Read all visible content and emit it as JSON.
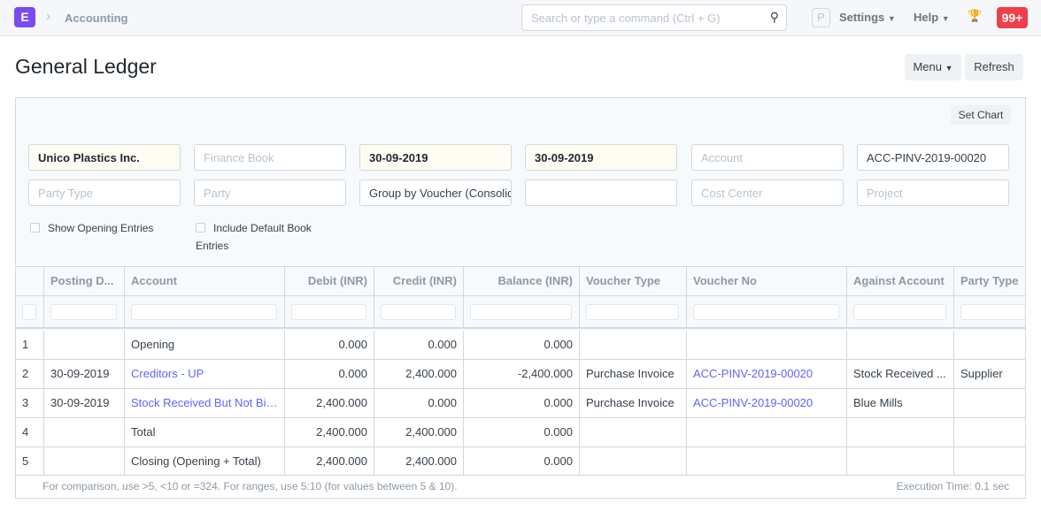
{
  "nav": {
    "logo": "E",
    "breadcrumb": "Accounting",
    "search_placeholder": "Search or type a command (Ctrl + G)",
    "avatar": "P",
    "settings": "Settings",
    "help": "Help",
    "notifications": "99+"
  },
  "page": {
    "title": "General Ledger",
    "menu": "Menu",
    "refresh": "Refresh",
    "set_chart": "Set Chart"
  },
  "filters": {
    "company": "Unico Plastics Inc.",
    "finance_book_ph": "Finance Book",
    "from_date": "30-09-2019",
    "to_date": "30-09-2019",
    "account_ph": "Account",
    "voucher_no": "ACC-PINV-2019-00020",
    "party_type_ph": "Party Type",
    "party_ph": "Party",
    "group_by": "Group by Voucher (Consolidated)",
    "blank": "",
    "cost_center_ph": "Cost Center",
    "project_ph": "Project",
    "show_opening": "Show Opening Entries",
    "include_default": "Include Default Book Entries"
  },
  "table": {
    "columns": [
      "",
      "Posting D...",
      "Account",
      "Debit (INR)",
      "Credit (INR)",
      "Balance (INR)",
      "Voucher Type",
      "Voucher No",
      "Against Account",
      "Party Type"
    ],
    "rows": [
      [
        "1",
        "",
        "Opening",
        "0.000",
        "0.000",
        "0.000",
        "",
        "",
        "",
        ""
      ],
      [
        "2",
        "30-09-2019",
        "Creditors - UP",
        "0.000",
        "2,400.000",
        "-2,400.000",
        "Purchase Invoice",
        "ACC-PINV-2019-00020",
        "Stock Received ...",
        "Supplier"
      ],
      [
        "3",
        "30-09-2019",
        "Stock Received But Not Bill...",
        "2,400.000",
        "0.000",
        "0.000",
        "Purchase Invoice",
        "ACC-PINV-2019-00020",
        "Blue Mills",
        ""
      ],
      [
        "4",
        "",
        "Total",
        "2,400.000",
        "2,400.000",
        "0.000",
        "",
        "",
        "",
        ""
      ],
      [
        "5",
        "",
        "Closing (Opening + Total)",
        "2,400.000",
        "2,400.000",
        "0.000",
        "",
        "",
        "",
        ""
      ]
    ]
  },
  "footer": {
    "hint": "For comparison, use >5, <10 or =324. For ranges, use 5:10 (for values between 5 & 10).",
    "exec_time": "Execution Time: 0.1 sec"
  }
}
